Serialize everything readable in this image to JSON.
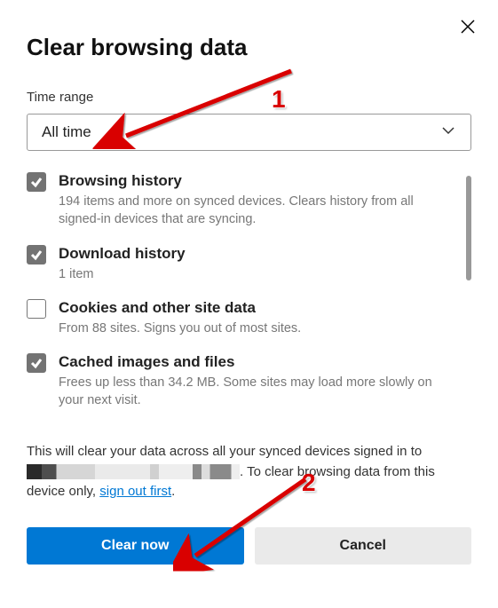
{
  "dialog": {
    "title": "Clear browsing data",
    "time_range_label": "Time range",
    "time_range_value": "All time"
  },
  "items": [
    {
      "checked": true,
      "title": "Browsing history",
      "desc": "194 items and more on synced devices. Clears history from all signed-in devices that are syncing."
    },
    {
      "checked": true,
      "title": "Download history",
      "desc": "1 item"
    },
    {
      "checked": false,
      "title": "Cookies and other site data",
      "desc": "From 88 sites. Signs you out of most sites."
    },
    {
      "checked": true,
      "title": "Cached images and files",
      "desc": "Frees up less than 34.2 MB. Some sites may load more slowly on your next visit."
    }
  ],
  "footer": {
    "line1": "This will clear your data across all your synced devices signed in to ",
    "line2": ". To clear browsing data from this device only, ",
    "link": "sign out first",
    "period": "."
  },
  "buttons": {
    "primary": "Clear now",
    "secondary": "Cancel"
  },
  "annotations": {
    "n1": "1",
    "n2": "2"
  }
}
